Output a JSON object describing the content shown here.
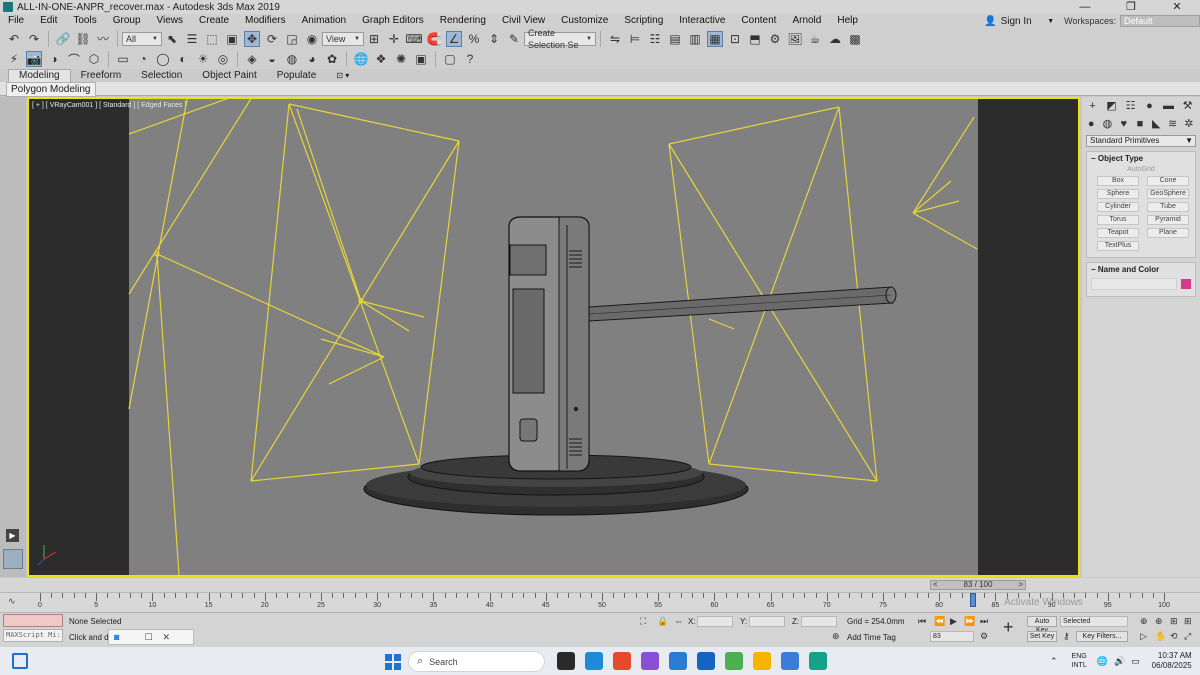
{
  "window": {
    "title": "ALL-IN-ONE-ANPR_recover.max - Autodesk 3ds Max 2019",
    "controls": [
      "—",
      "❐",
      "✕"
    ]
  },
  "menubar": {
    "items": [
      "File",
      "Edit",
      "Tools",
      "Group",
      "Views",
      "Create",
      "Modifiers",
      "Animation",
      "Graph Editors",
      "Rendering",
      "Civil View",
      "Customize",
      "Scripting",
      "Interactive",
      "Content",
      "Arnold",
      "Help"
    ],
    "sign_in": "Sign In",
    "workspaces_label": "Workspaces:",
    "workspaces_value": "Default"
  },
  "toolbar": {
    "selection_filter": "All",
    "reference_coord": "View",
    "named_selection_placeholder": "Create Selection Se"
  },
  "ribbon": {
    "tabs": [
      "Modeling",
      "Freeform",
      "Selection",
      "Object Paint",
      "Populate"
    ],
    "active_tab": "Modeling",
    "sub_tab": "Polygon Modeling"
  },
  "viewport": {
    "label": "[ + ] [ VRayCam001 ] [ Standard ] [ Edged Faces ]",
    "accent_color": "#f0e20a"
  },
  "command_panel": {
    "dropdown": "Standard Primitives",
    "object_type_title": "Object Type",
    "autogrid": "AutoGrid",
    "buttons": [
      "Box",
      "Cone",
      "Sphere",
      "GeoSphere",
      "Cylinder",
      "Tube",
      "Torus",
      "Pyramid",
      "Teapot",
      "Plane",
      "TextPlus"
    ],
    "name_color_title": "Name and Color",
    "swatch_color": "#d63a8e"
  },
  "timeline": {
    "slider_text": "83 / 100",
    "slider_left": "<",
    "slider_right": ">",
    "tick_labels": [
      "0",
      "5",
      "10",
      "15",
      "20",
      "25",
      "30",
      "35",
      "40",
      "45",
      "50",
      "55",
      "60",
      "65",
      "70",
      "75",
      "80",
      "85",
      "90",
      "95",
      "100"
    ]
  },
  "statusbar": {
    "maxscript": "MAXScript Mi:",
    "selection_status": "None Selected",
    "prompt": "Click and dr",
    "x_label": "X:",
    "x_value": "",
    "y_label": "Y:",
    "y_value": "",
    "z_label": "Z:",
    "z_value": "",
    "grid": "Grid = 254.0mm",
    "add_time_tag": "Add Time Tag",
    "auto_key": "Auto Key",
    "selected": "Selected",
    "set_key": "Set Key",
    "key_filters": "Key Filters...",
    "frame": "83",
    "watermark": "Activate Windows"
  },
  "taskbar": {
    "search": "Search",
    "lang_top": "ENG",
    "lang_bottom": "INTL",
    "time": "10:37 AM",
    "date": "06/08/2025",
    "app_colors": [
      "#2a2a2a",
      "#1f8ad6",
      "#e44b2a",
      "#8a4fd6",
      "#2b7cd3",
      "#1565c0",
      "#4caf50",
      "#f4b400",
      "#3d7bd9",
      "#17a08a"
    ]
  }
}
